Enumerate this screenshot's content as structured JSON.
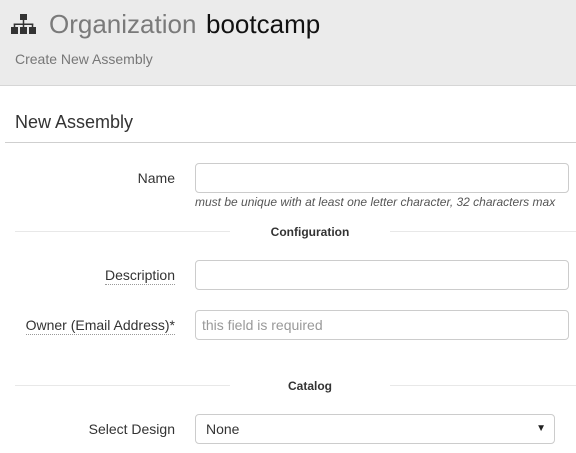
{
  "header": {
    "icon": "sitemap-icon",
    "org_word": "Organization",
    "org_name": "bootcamp",
    "subtitle": "Create New Assembly"
  },
  "form": {
    "title": "New Assembly",
    "name": {
      "label": "Name",
      "value": "",
      "placeholder": "",
      "help": "must be unique with at least one letter character, 32 characters max"
    },
    "configuration_heading": "Configuration",
    "description": {
      "label": "Description",
      "value": "",
      "placeholder": ""
    },
    "owner": {
      "label": "Owner (Email Address)*",
      "value": "",
      "placeholder": "this field is required"
    },
    "catalog_heading": "Catalog",
    "select_design": {
      "label": "Select Design",
      "selected": "None",
      "icon": "caret-down-icon"
    }
  },
  "colors": {
    "header_bg": "#ebebeb",
    "text": "#333333",
    "muted": "#7a7a7a"
  }
}
